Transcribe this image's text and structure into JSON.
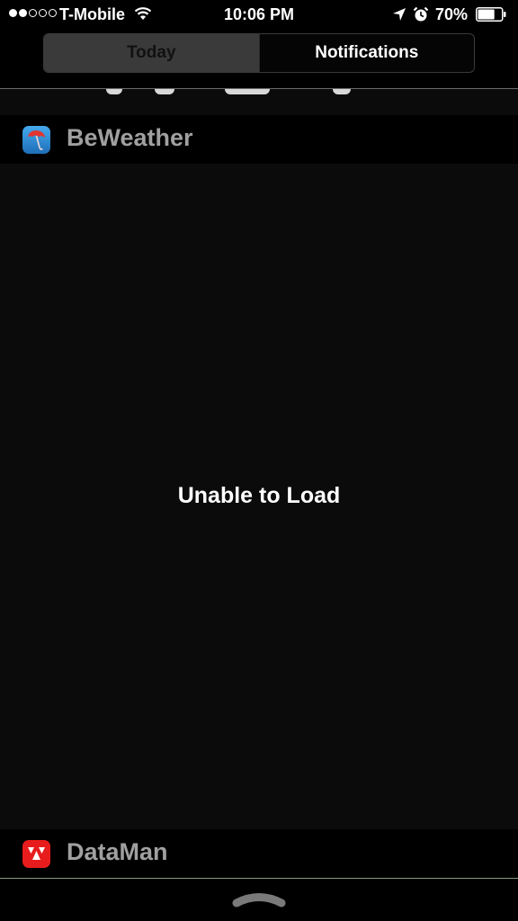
{
  "status_bar": {
    "signal_bars_filled": 2,
    "signal_bars_total": 5,
    "carrier": "T-Mobile",
    "time": "10:06 PM",
    "battery_percent": "70%",
    "battery_level": 0.7,
    "icons": [
      "wifi-icon",
      "location-arrow-icon",
      "alarm-clock-icon",
      "battery-icon"
    ]
  },
  "segmented_control": {
    "today_label": "Today",
    "notifications_label": "Notifications",
    "selected": "Today"
  },
  "widgets": [
    {
      "app_name": "BeWeather",
      "icon": "umbrella-app-icon",
      "status_text": "Unable to Load"
    },
    {
      "app_name": "DataMan",
      "icon": "dataman-app-icon"
    }
  ],
  "colors": {
    "background": "#0b0b0b",
    "header_background": "#000000",
    "selected_segment": "#3a3a3a",
    "app_name_text": "#a0a0a0",
    "beweather_icon": "#2f8fd8",
    "dataman_icon": "#e81c1c"
  },
  "footer": {
    "icon": "grabber-handle-icon"
  }
}
